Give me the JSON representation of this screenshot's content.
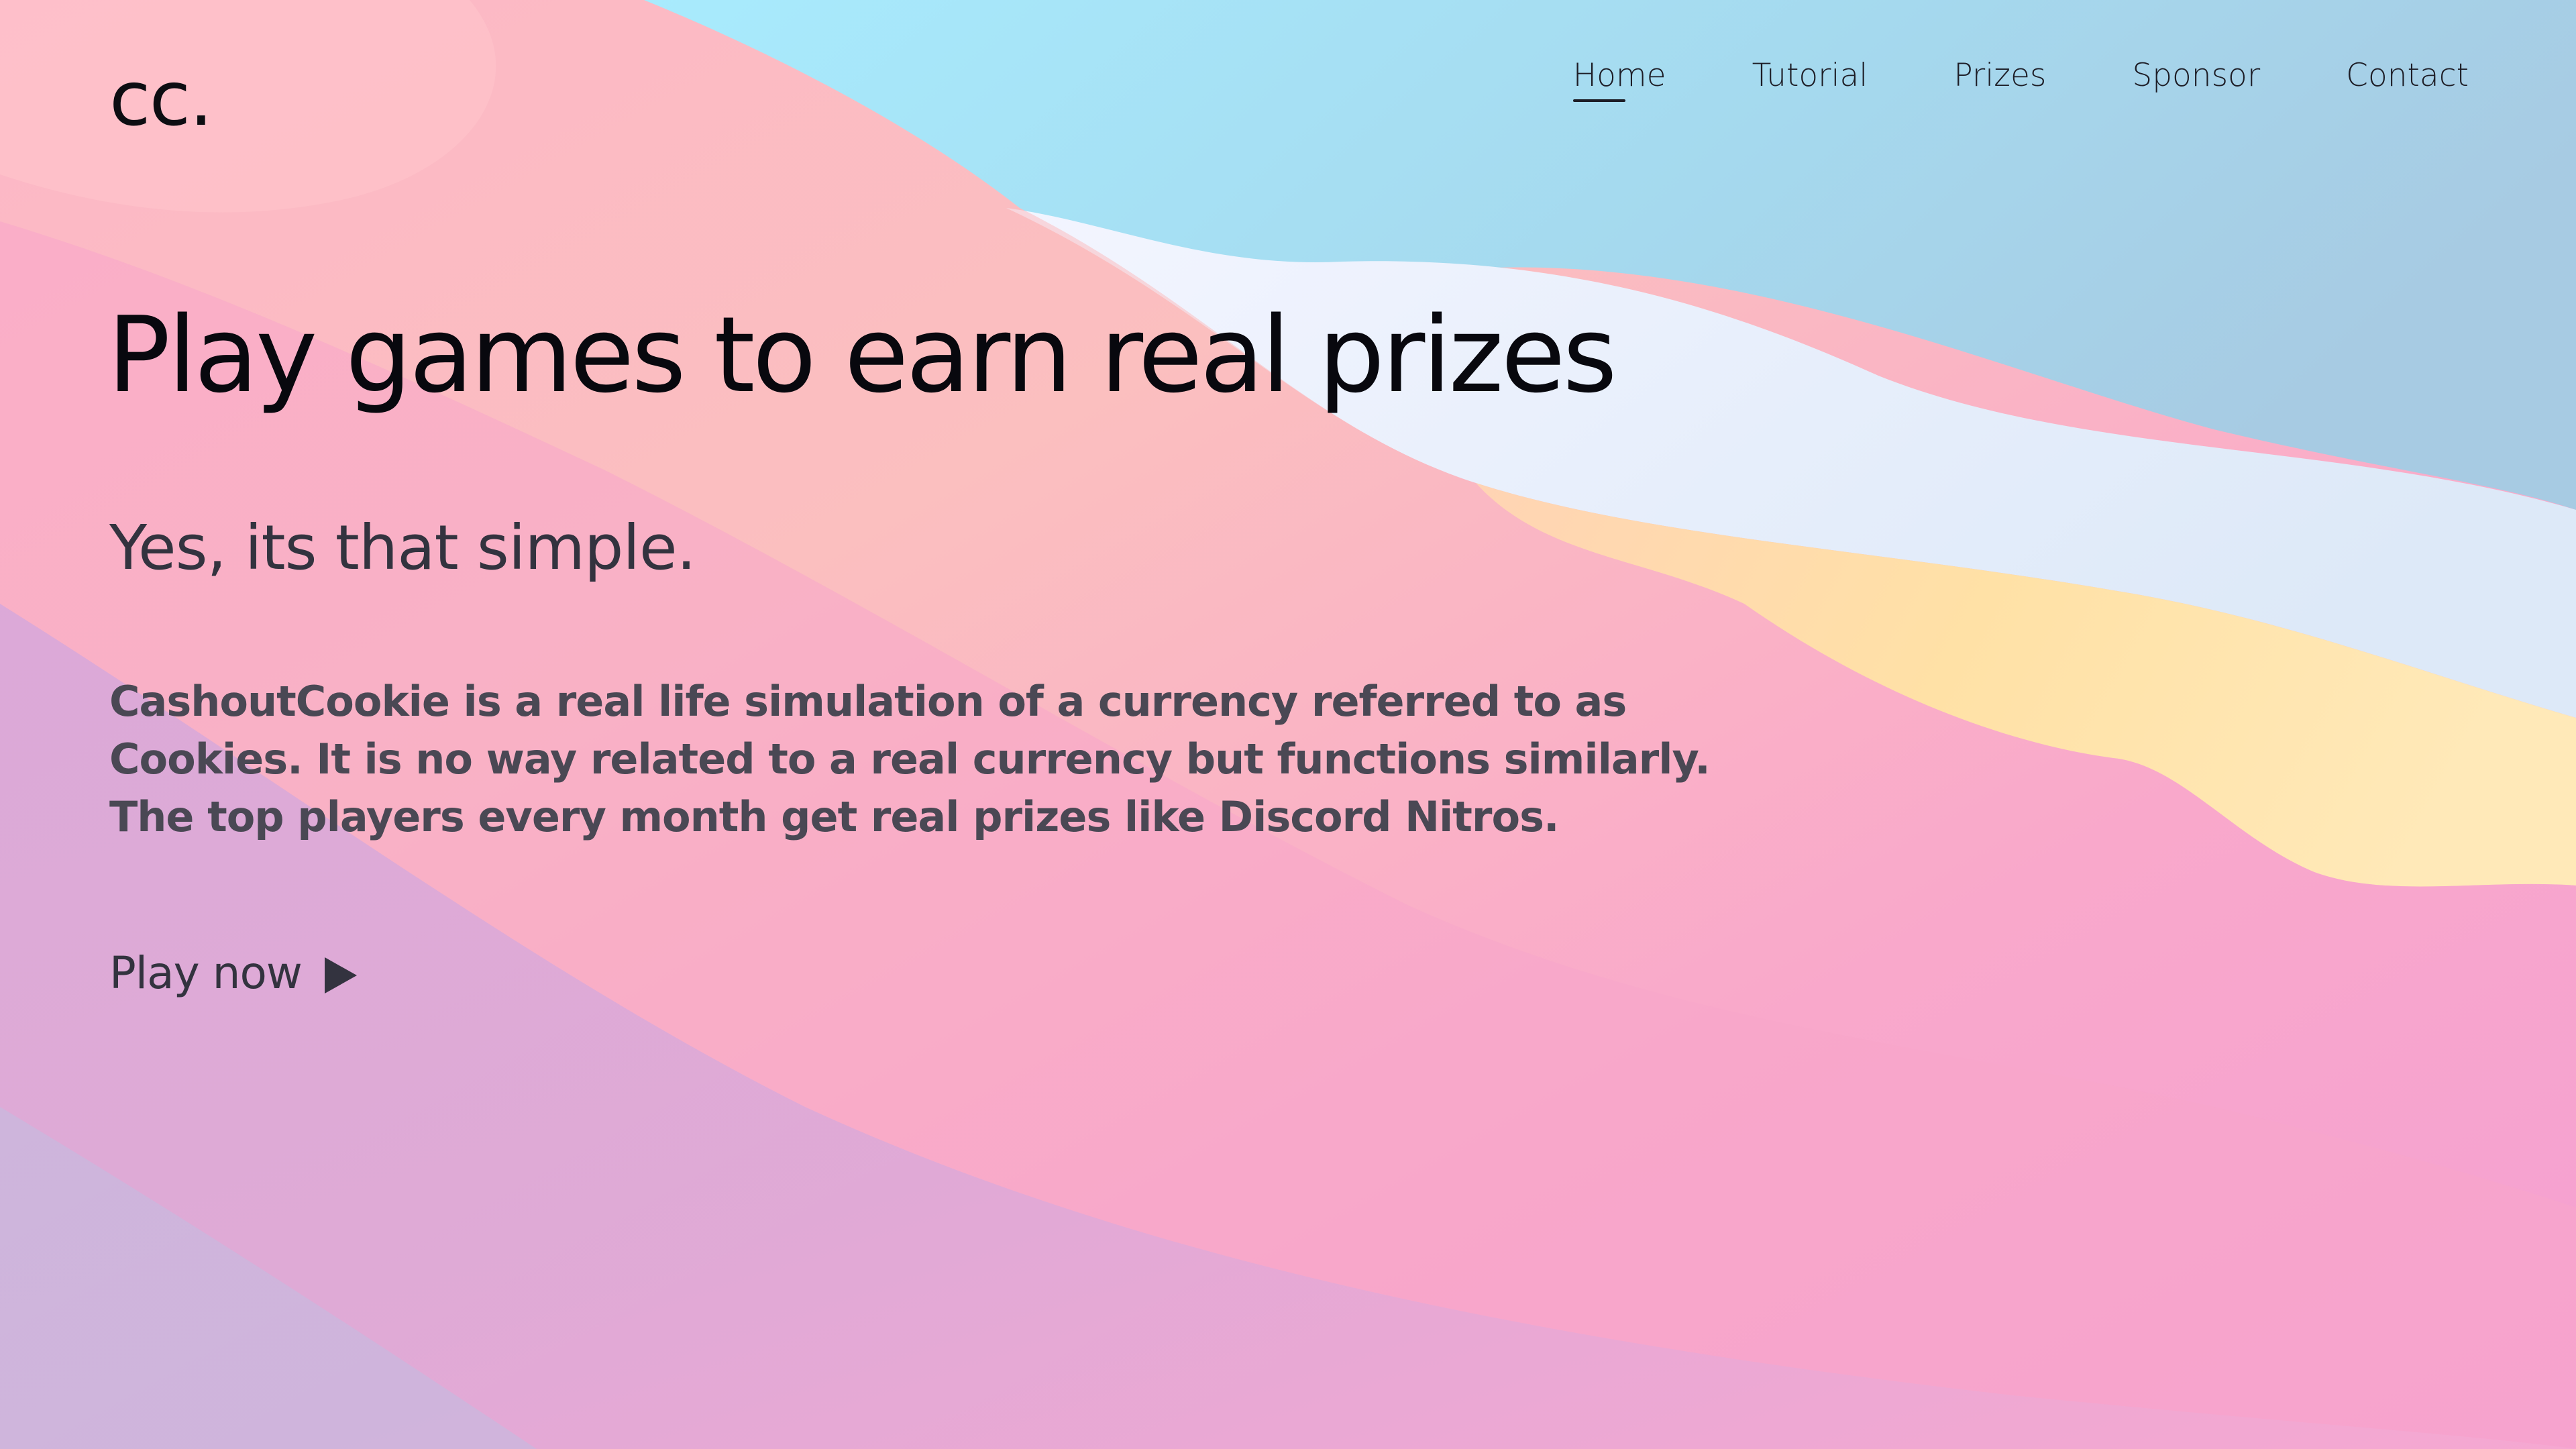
{
  "header": {
    "logo_text": "cc.",
    "nav_items": [
      {
        "label": "Home",
        "active": true
      },
      {
        "label": "Tutorial",
        "active": false
      },
      {
        "label": "Prizes",
        "active": false
      },
      {
        "label": "Sponsor",
        "active": false
      },
      {
        "label": "Contact",
        "active": false
      }
    ]
  },
  "hero": {
    "title": "Play games to earn real prizes",
    "subtitle": "Yes, its that simple.",
    "description": "CashoutCookie is a real life simulation of a currency referred to as Cookies. It is no way related to a real currency but functions similarly. The top players every month get real prizes like Discord Nitros.",
    "cta_label": "Play now",
    "cta_icon": "play-icon"
  },
  "colors": {
    "sky_blue": "#a9e6f7",
    "white_band": "#eef3fb",
    "yellow_band": "#ffe0a8",
    "pink": "#f9a9c8",
    "lilac": "#d3aee0",
    "text_dark": "#0d0d12"
  }
}
